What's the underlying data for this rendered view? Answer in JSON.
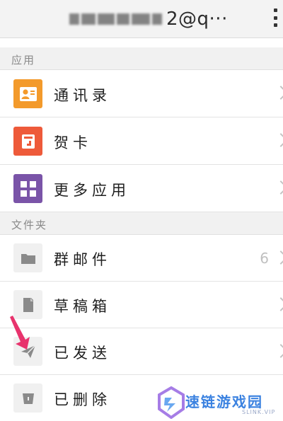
{
  "header": {
    "account_visible": "2@q···"
  },
  "sections": {
    "apps": "应用",
    "folders": "文件夹"
  },
  "apps": [
    {
      "label": "通讯录",
      "icon": "contacts-icon",
      "color": "#f39a2b"
    },
    {
      "label": "贺卡",
      "icon": "greeting-card-icon",
      "color": "#ee5a3a"
    },
    {
      "label": "更多应用",
      "icon": "more-apps-icon",
      "color": "#7a54a8"
    }
  ],
  "folders": [
    {
      "label": "群邮件",
      "icon": "folder-icon",
      "count": "6"
    },
    {
      "label": "草稿箱",
      "icon": "draft-icon"
    },
    {
      "label": "已发送",
      "icon": "sent-icon"
    },
    {
      "label": "已删除",
      "icon": "trash-icon"
    }
  ],
  "watermark": {
    "title": "速链游戏园",
    "subtitle": "SLINK.VIP"
  },
  "colors": {
    "pointer": "#e8336d",
    "watermark": "#3b82e0"
  }
}
